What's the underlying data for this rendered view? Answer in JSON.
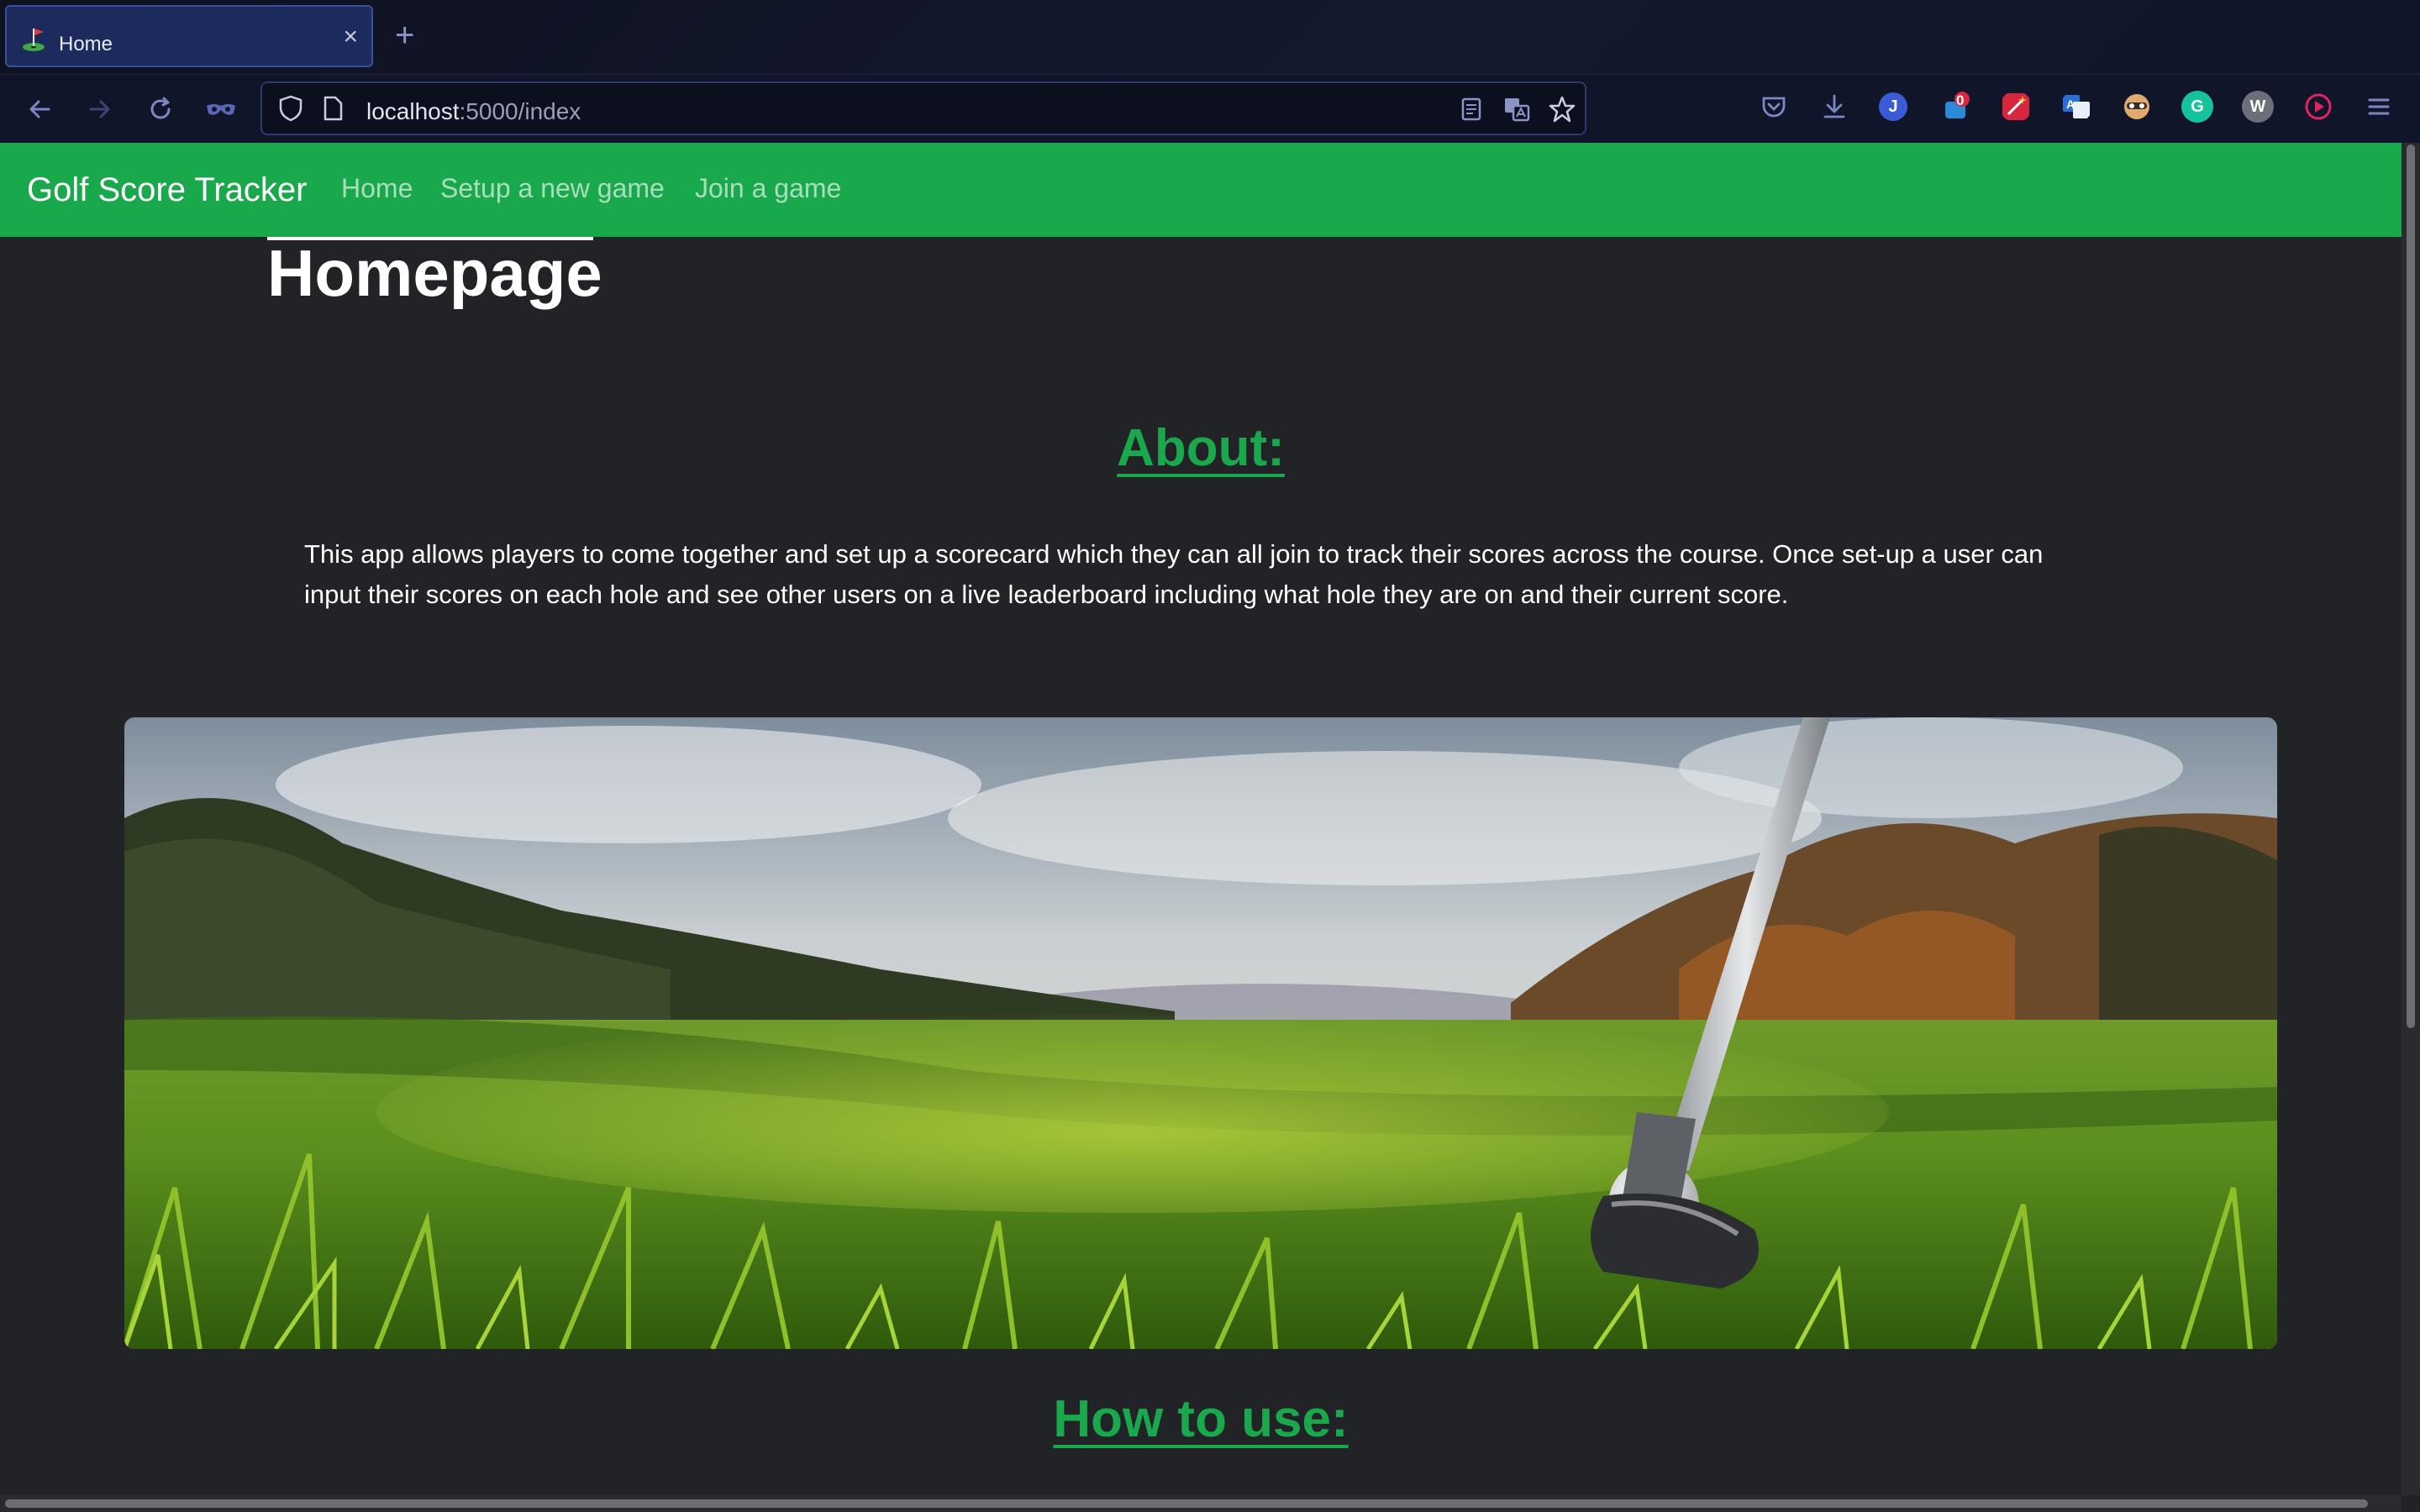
{
  "browser": {
    "tab_title": "Home",
    "tab_close": "×",
    "new_tab": "+",
    "url_host": "localhost",
    "url_path": ":5000/index",
    "notification_count": "0",
    "extensions": [
      {
        "name": "pocket-icon",
        "color": "#7c87c4"
      },
      {
        "name": "downloads-icon",
        "color": "#7c87c4"
      },
      {
        "name": "profile-j-icon",
        "label": "J",
        "color": "#3b5bd6"
      },
      {
        "name": "notifications-icon",
        "color": "#2a8bd8"
      },
      {
        "name": "magic-wand-extension-icon",
        "color": "#d7263d"
      },
      {
        "name": "translate-extension-icon",
        "color": "#2a6fd8"
      },
      {
        "name": "mask-extension-icon",
        "color": "#e0a96d"
      },
      {
        "name": "grammarly-icon",
        "label": "G",
        "color": "#15c39a"
      },
      {
        "name": "w-extension-icon",
        "label": "W",
        "color": "#6b6f7a"
      },
      {
        "name": "play-extension-icon",
        "color": "#e0245e"
      }
    ]
  },
  "site": {
    "brand": "Golf Score Tracker",
    "nav": [
      "Home",
      "Setup a new game",
      "Join a game"
    ]
  },
  "page": {
    "title": "Homepage",
    "about_heading": "About:",
    "about_text": "This app allows players to come together and set up a scorecard which they can all join to track their scores across the course. Once set-up a user can input their scores on each hole and see other users on a live leaderboard including what hole they are on and their current score.",
    "how_heading": "How to use:"
  },
  "colors": {
    "accent_green": "#1aa84c",
    "page_bg": "#222327"
  }
}
